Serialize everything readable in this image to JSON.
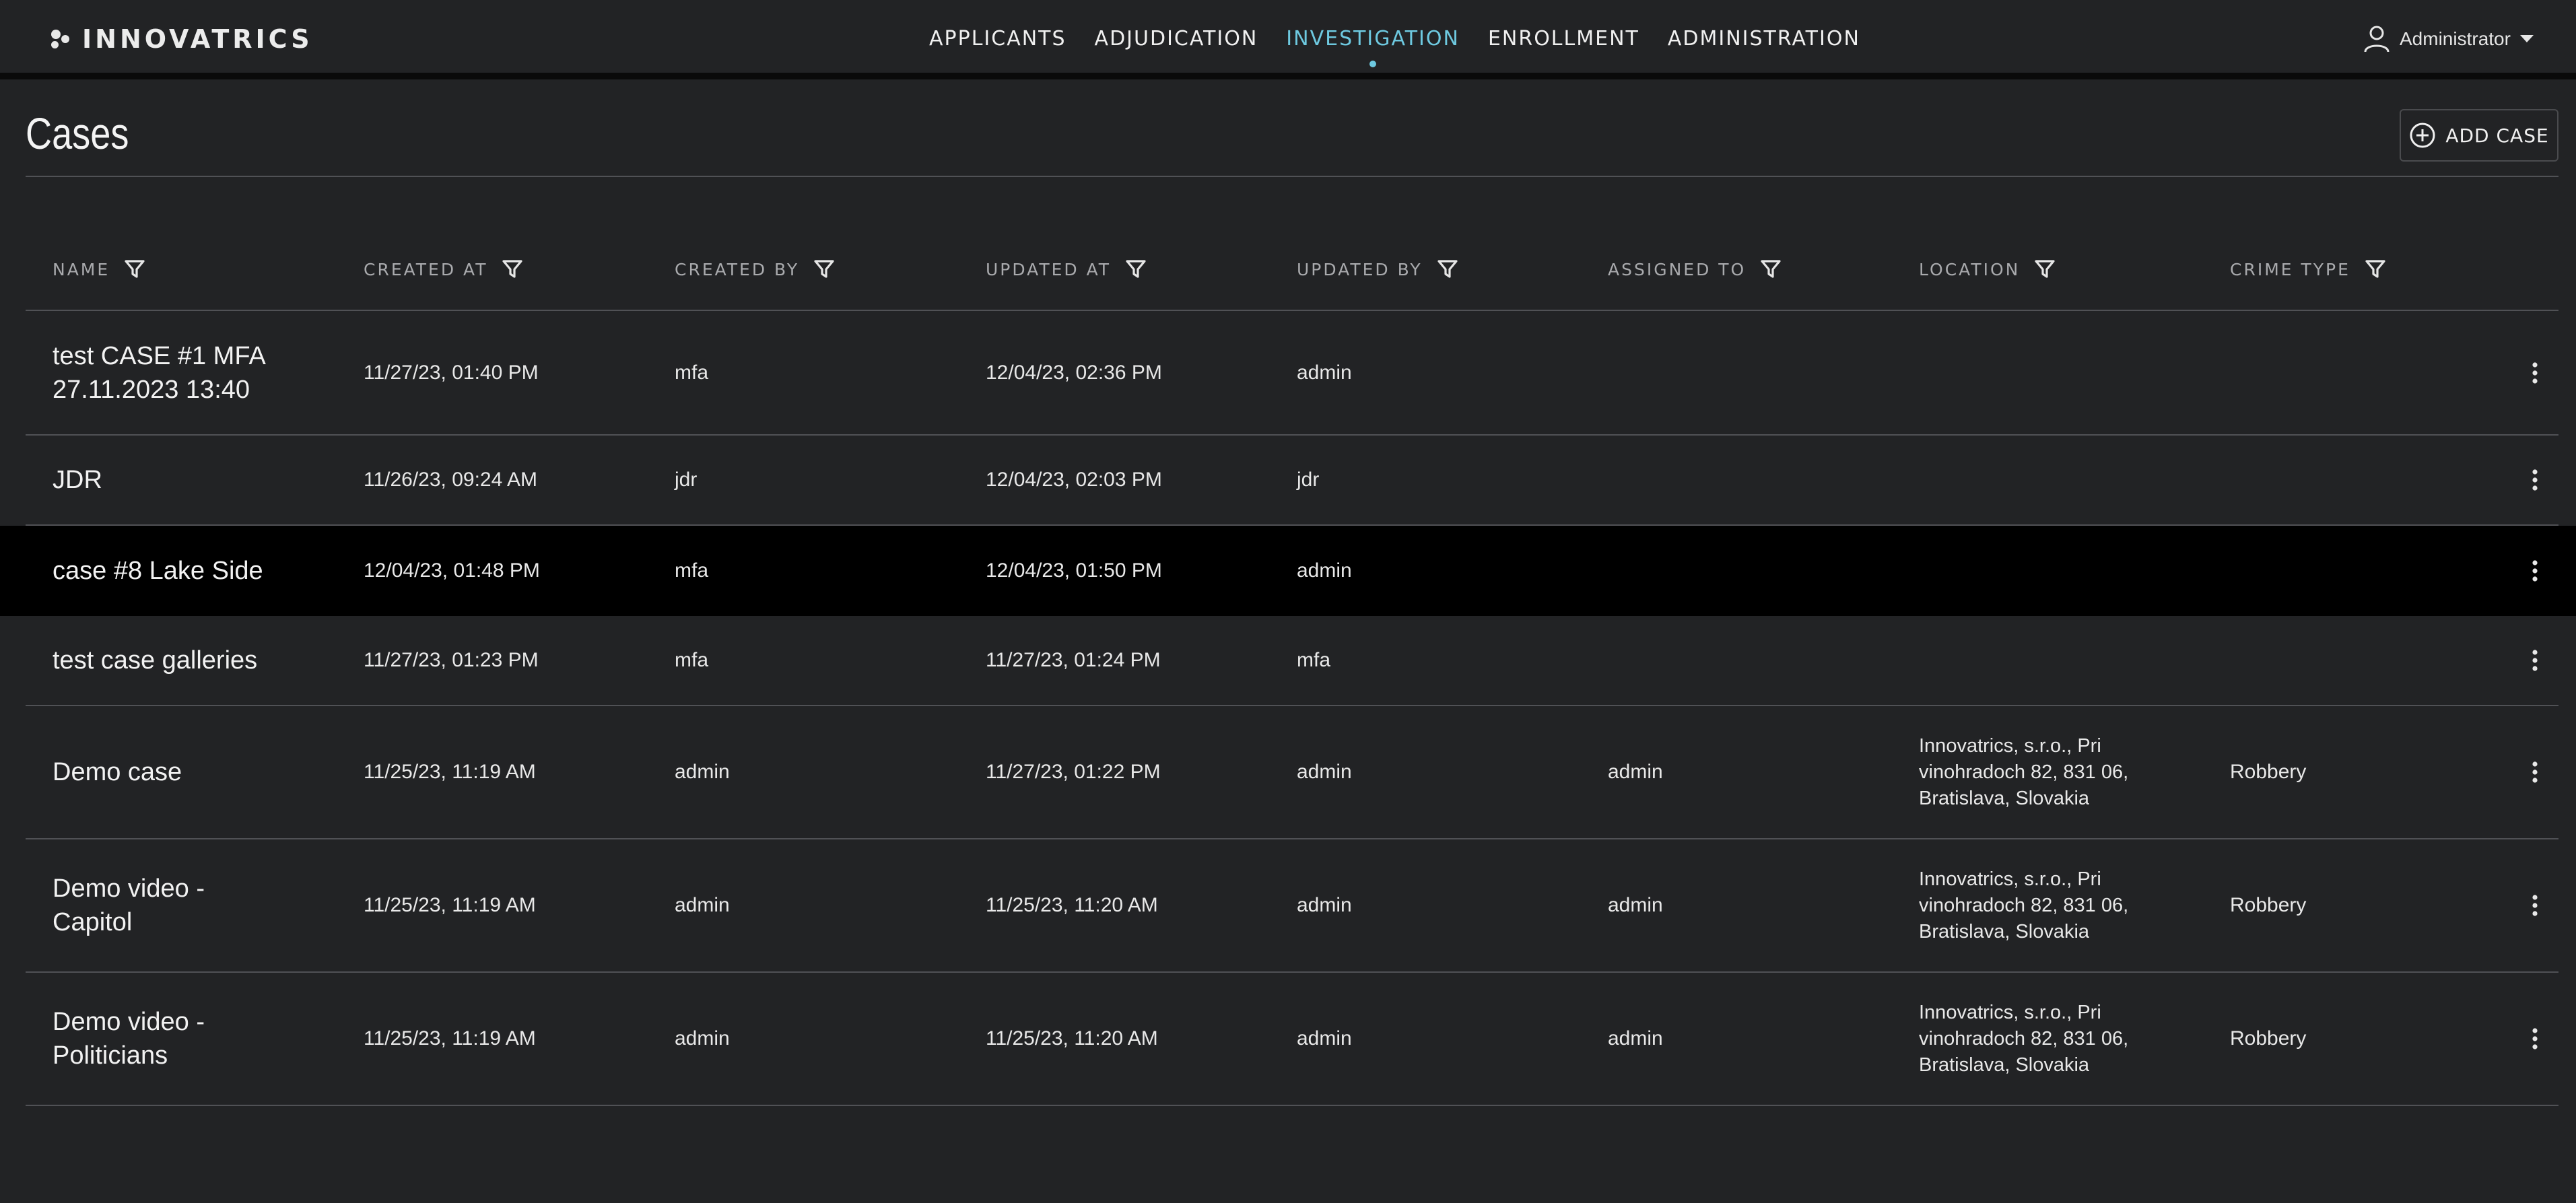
{
  "brand": "INNOVATRICS",
  "nav": [
    {
      "label": "APPLICANTS"
    },
    {
      "label": "ADJUDICATION"
    },
    {
      "label": "INVESTIGATION",
      "active": true
    },
    {
      "label": "ENROLLMENT"
    },
    {
      "label": "ADMINISTRATION"
    }
  ],
  "user": {
    "name": "Administrator",
    "icon": "user-icon"
  },
  "page": {
    "title": "Cases",
    "add_label": "ADD CASE"
  },
  "colors": {
    "accent": "#6ec9e0",
    "background": "#222325",
    "highlight_row": "#000000"
  },
  "table": {
    "columns": [
      "NAME",
      "CREATED AT",
      "CREATED BY",
      "UPDATED AT",
      "UPDATED BY",
      "ASSIGNED TO",
      "LOCATION",
      "CRIME TYPE"
    ],
    "rows": [
      {
        "name": [
          "test CASE #1 MFA",
          "27.11.2023 13:40"
        ],
        "created_at": "11/27/23, 01:40 PM",
        "created_by": "mfa",
        "updated_at": "12/04/23, 02:36 PM",
        "updated_by": "admin",
        "assigned_to": "",
        "location": [],
        "crime_type": ""
      },
      {
        "name": [
          "JDR"
        ],
        "created_at": "11/26/23, 09:24 AM",
        "created_by": "jdr",
        "updated_at": "12/04/23, 02:03 PM",
        "updated_by": "jdr",
        "assigned_to": "",
        "location": [],
        "crime_type": ""
      },
      {
        "name": [
          "case #8 Lake Side"
        ],
        "created_at": "12/04/23, 01:48 PM",
        "created_by": "mfa",
        "updated_at": "12/04/23, 01:50 PM",
        "updated_by": "admin",
        "assigned_to": "",
        "location": [],
        "crime_type": "",
        "highlighted": true
      },
      {
        "name": [
          "test case galleries"
        ],
        "created_at": "11/27/23, 01:23 PM",
        "created_by": "mfa",
        "updated_at": "11/27/23, 01:24 PM",
        "updated_by": "mfa",
        "assigned_to": "",
        "location": [],
        "crime_type": ""
      },
      {
        "name": [
          "Demo case"
        ],
        "created_at": "11/25/23, 11:19 AM",
        "created_by": "admin",
        "updated_at": "11/27/23, 01:22 PM",
        "updated_by": "admin",
        "assigned_to": "admin",
        "location": [
          "Innovatrics, s.r.o., Pri",
          "vinohradoch 82, 831 06,",
          "Bratislava, Slovakia"
        ],
        "crime_type": "Robbery"
      },
      {
        "name": [
          "Demo video -",
          "Capitol"
        ],
        "created_at": "11/25/23, 11:19 AM",
        "created_by": "admin",
        "updated_at": "11/25/23, 11:20 AM",
        "updated_by": "admin",
        "assigned_to": "admin",
        "location": [
          "Innovatrics, s.r.o., Pri",
          "vinohradoch 82, 831 06,",
          "Bratislava, Slovakia"
        ],
        "crime_type": "Robbery"
      },
      {
        "name": [
          "Demo video -",
          "Politicians"
        ],
        "created_at": "11/25/23, 11:19 AM",
        "created_by": "admin",
        "updated_at": "11/25/23, 11:20 AM",
        "updated_by": "admin",
        "assigned_to": "admin",
        "location": [
          "Innovatrics, s.r.o., Pri",
          "vinohradoch 82, 831 06,",
          "Bratislava, Slovakia"
        ],
        "crime_type": "Robbery"
      }
    ]
  }
}
